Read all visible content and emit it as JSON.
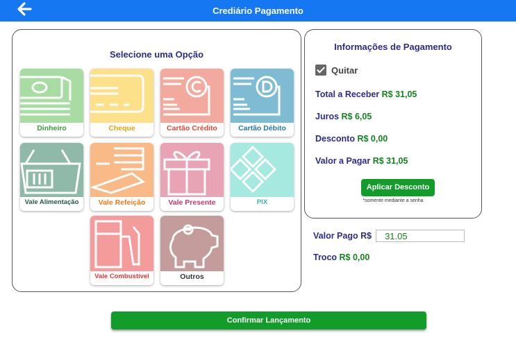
{
  "header": {
    "title": "Crediário Pagamento",
    "back_icon": "arrow-left-icon"
  },
  "options": {
    "title": "Selecione uma Opção",
    "tiles": [
      {
        "label": "Dinheiro",
        "color": "#a9dca3",
        "label_color": "#3e9a3a",
        "icon": "cash-icon"
      },
      {
        "label": "Cheque",
        "color": "#fce08a",
        "label_color": "#e2a60c",
        "icon": "cheque-icon"
      },
      {
        "label": "Cartão Crédito",
        "color": "#f2a99e",
        "label_color": "#e0483a",
        "icon": "credit-card-icon"
      },
      {
        "label": "Cartão Débito",
        "color": "#7fbcd4",
        "label_color": "#2478a6",
        "icon": "debit-card-icon"
      },
      {
        "label": "Vale Alimentação",
        "color": "#8fb9a8",
        "label_color": "#1e5b46",
        "icon": "basket-icon"
      },
      {
        "label": "Vale Refeição",
        "color": "#f9ba88",
        "label_color": "#f07b1f",
        "icon": "meal-icon"
      },
      {
        "label": "Vale Presente",
        "color": "#e8a3b5",
        "label_color": "#c9386e",
        "icon": "gift-icon"
      },
      {
        "label": "PIX",
        "color": "#a6e9e1",
        "label_color": "#37b3a8",
        "icon": "pix-icon"
      },
      {
        "label": "Vale Combustível",
        "color": "#f49c9c",
        "label_color": "#e53935",
        "icon": "fuel-pump-icon"
      },
      {
        "label": "Outros",
        "color": "#c59c9c",
        "label_color": "#333333",
        "icon": "piggy-bank-icon"
      }
    ]
  },
  "payment_info": {
    "title": "Informações de Pagamento",
    "quitar_label": "Quitar",
    "quitar_checked": true,
    "total_label": "Total a Receber",
    "total_value": "R$ 31,05",
    "juros_label": "Juros",
    "juros_value": "R$ 6,05",
    "desconto_label": "Desconto",
    "desconto_value": "R$ 0,00",
    "valor_pagar_label": "Valor a Pagar",
    "valor_pagar_value": "R$ 31,05",
    "apply_discount_label": "Aplicar Desconto",
    "apply_discount_note": "*somente mediante a senha"
  },
  "valor_pago": {
    "label": "Valor Pago R$",
    "value": "31.05"
  },
  "troco": {
    "label": "Troco",
    "value": "R$ 0,00"
  },
  "confirm_label": "Confirmar Lançamento",
  "colors": {
    "header": "#1677f2",
    "accent_green": "#129d2a",
    "title_blue": "#2b2b8c",
    "value_green": "#13841f"
  }
}
